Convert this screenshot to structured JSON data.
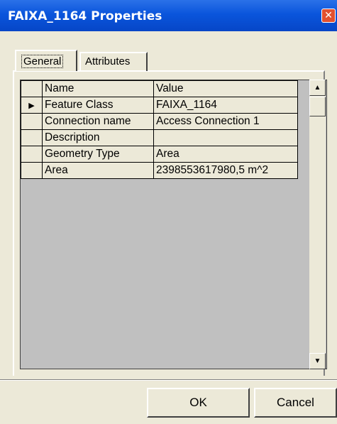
{
  "window": {
    "title": "FAIXA_1164 Properties",
    "close_glyph": "✕"
  },
  "tabs": [
    {
      "label": "General"
    },
    {
      "label": "Attributes"
    }
  ],
  "grid": {
    "columns": [
      "Name",
      "Value"
    ],
    "rows": [
      {
        "name": "Feature Class",
        "value": "FAIXA_1164"
      },
      {
        "name": "Connection name",
        "value": "Access Connection 1"
      },
      {
        "name": "Description",
        "value": ""
      },
      {
        "name": "Geometry Type",
        "value": "Area"
      },
      {
        "name": "Area",
        "value": "2398553617980,5 m^2"
      }
    ],
    "current_row_marker": "▶"
  },
  "scroll": {
    "up": "▲",
    "down": "▼"
  },
  "buttons": {
    "ok": "OK",
    "cancel": "Cancel"
  },
  "icons": {
    "close": "close-icon",
    "current_row": "row-pointer-icon",
    "scroll_up": "arrow-up-icon",
    "scroll_down": "arrow-down-icon"
  },
  "colors": {
    "titlebar": "#0a55dc",
    "dialog_bg": "#ece9d8",
    "grid_bg": "#c0c0c0",
    "close_button": "#e2502f"
  }
}
